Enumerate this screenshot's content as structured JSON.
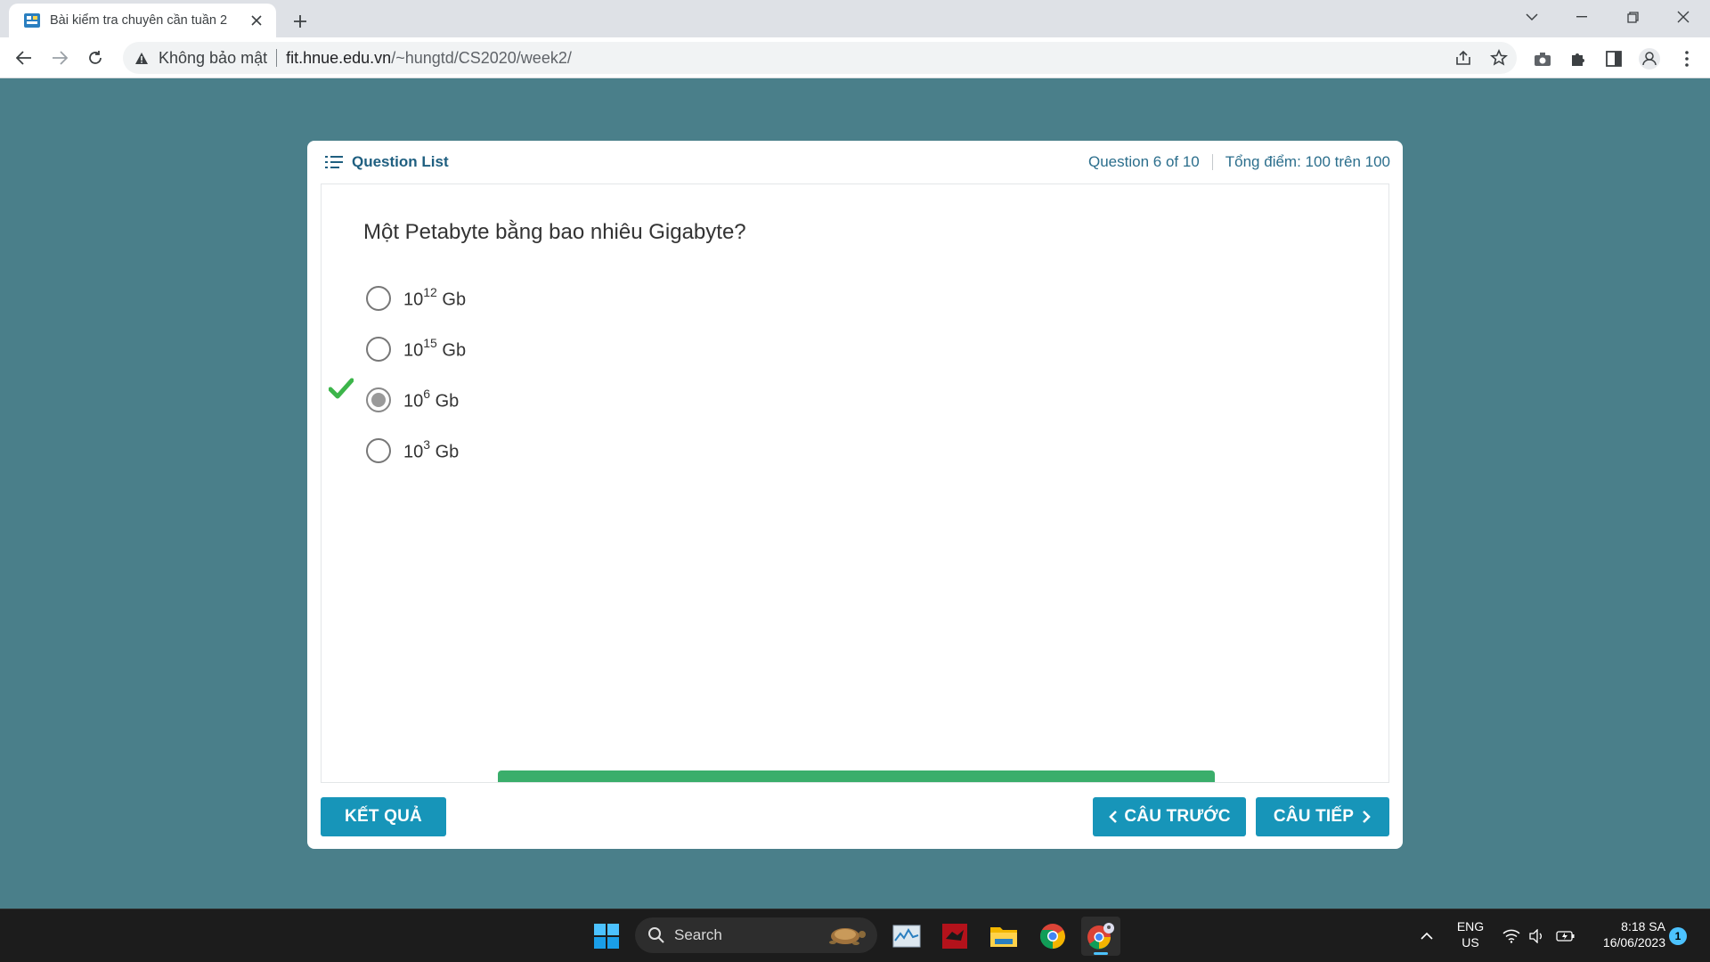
{
  "browser": {
    "tab_title": "Bài kiểm tra chuyên cần tuần 2",
    "security_label": "Không bảo mật",
    "url_host": "fit.hnue.edu.vn",
    "url_path": "/~hungtd/CS2020/week2/"
  },
  "quiz": {
    "question_list_label": "Question List",
    "progress": "Question 6 of 10",
    "score": "Tổng điểm: 100 trên 100",
    "question": "Một Petabyte bằng bao nhiêu Gigabyte?",
    "options": [
      {
        "base": "10",
        "exp": "12",
        "unit": " Gb",
        "selected": false,
        "correct": false
      },
      {
        "base": "10",
        "exp": "15",
        "unit": " Gb",
        "selected": false,
        "correct": false
      },
      {
        "base": "10",
        "exp": "6",
        "unit": " Gb",
        "selected": true,
        "correct": true
      },
      {
        "base": "10",
        "exp": "3",
        "unit": " Gb",
        "selected": false,
        "correct": false
      }
    ],
    "result_button": "KẾT QUẢ",
    "prev_button": "CÂU TRƯỚC",
    "next_button": "CÂU TIẾP"
  },
  "taskbar": {
    "search_placeholder": "Search",
    "lang_line1": "ENG",
    "lang_line2": "US",
    "time": "8:18 SA",
    "date": "16/06/2023",
    "notification_count": "1"
  },
  "colors": {
    "page_bg": "#4a7f8a",
    "button_bg": "#1795b9",
    "correct_check": "#3cb54a",
    "feedback_bar": "#3aae6b"
  }
}
